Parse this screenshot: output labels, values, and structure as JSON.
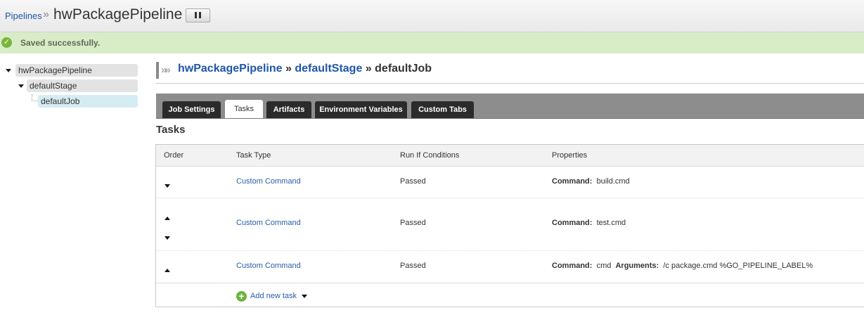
{
  "header": {
    "breadcrumb_link": "Pipelines",
    "separator": "»",
    "title": "hwPackagePipeline"
  },
  "flash": {
    "icon": "check-icon",
    "message": "Saved successfully."
  },
  "tree": [
    {
      "label": "hwPackagePipeline"
    },
    {
      "label": "defaultStage"
    },
    {
      "label": "defaultJob",
      "selected": true
    }
  ],
  "page_heading": {
    "pipeline": "hwPackagePipeline",
    "stage": "defaultStage",
    "job": "defaultJob",
    "sep": "»"
  },
  "tabs": [
    {
      "label": "Job Settings"
    },
    {
      "label": "Tasks",
      "active": true
    },
    {
      "label": "Artifacts"
    },
    {
      "label": "Environment Variables"
    },
    {
      "label": "Custom Tabs"
    }
  ],
  "section_title": "Tasks",
  "table": {
    "headers": [
      "Order",
      "Task Type",
      "Run If Conditions",
      "Properties"
    ],
    "rows": [
      {
        "type": "Custom Command",
        "run_if": "Passed",
        "command_label": "Command:",
        "command": "build.cmd"
      },
      {
        "type": "Custom Command",
        "run_if": "Passed",
        "command_label": "Command:",
        "command": "test.cmd"
      },
      {
        "type": "Custom Command",
        "run_if": "Passed",
        "command_label": "Command:",
        "command": "cmd",
        "args_label": "Arguments:",
        "args": "/c package.cmd %GO_PIPELINE_LABEL%"
      }
    ],
    "add_task": "Add new task"
  },
  "colors": {
    "link": "#1f56a8",
    "flash_bg": "#d9ecc8",
    "tabs_bar": "#8d8d8d",
    "tab": "#2b2b2b"
  }
}
